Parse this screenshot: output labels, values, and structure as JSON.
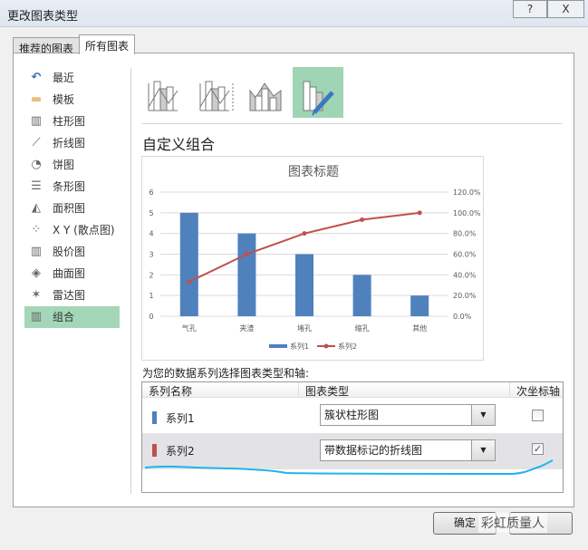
{
  "window": {
    "title": "更改图表类型",
    "help_label": "?",
    "close_label": "X"
  },
  "tabs": [
    {
      "label": "推荐的图表",
      "active": false
    },
    {
      "label": "所有图表",
      "active": true
    }
  ],
  "sidebar": {
    "items": [
      {
        "label": "最近",
        "icon": "undo-icon"
      },
      {
        "label": "模板",
        "icon": "folder-icon"
      },
      {
        "label": "柱形图",
        "icon": "column-chart-icon"
      },
      {
        "label": "折线图",
        "icon": "line-chart-icon"
      },
      {
        "label": "饼图",
        "icon": "pie-chart-icon"
      },
      {
        "label": "条形图",
        "icon": "bar-chart-icon"
      },
      {
        "label": "面积图",
        "icon": "area-chart-icon"
      },
      {
        "label": "X Y (散点图)",
        "icon": "scatter-chart-icon"
      },
      {
        "label": "股价图",
        "icon": "stock-chart-icon"
      },
      {
        "label": "曲面图",
        "icon": "surface-chart-icon"
      },
      {
        "label": "雷达图",
        "icon": "radar-chart-icon"
      },
      {
        "label": "组合",
        "icon": "combo-chart-icon",
        "selected": true
      }
    ],
    "selected_color": "#a3d7b8"
  },
  "main": {
    "section_title": "自定义组合",
    "series_prompt": "为您的数据系列选择图表类型和轴:"
  },
  "chart_data": {
    "type": "bar+line",
    "title": "图表标题",
    "categories": [
      "气孔",
      "夹渣",
      "堵孔",
      "缩孔",
      "其他"
    ],
    "series": [
      {
        "name": "系列1",
        "type": "bar",
        "axis": "primary",
        "color": "#4f81bd",
        "values": [
          5,
          4,
          3,
          2,
          1
        ]
      },
      {
        "name": "系列2",
        "type": "line",
        "axis": "secondary",
        "color": "#c0504d",
        "values": [
          33.3,
          60.0,
          80.0,
          93.3,
          100.0
        ]
      }
    ],
    "ylim": [
      0,
      6
    ],
    "yticks": [
      "0",
      "1",
      "2",
      "3",
      "4",
      "5",
      "6"
    ],
    "y2lim": [
      0,
      120
    ],
    "y2ticks": [
      "0.0%",
      "20.0%",
      "40.0%",
      "60.0%",
      "80.0%",
      "100.0%",
      "120.0%"
    ],
    "grid": true,
    "legend": "bottom"
  },
  "table": {
    "headers": [
      "系列名称",
      "图表类型",
      "次坐标轴"
    ],
    "rows": [
      {
        "name": "系列1",
        "color": "#4f81bd",
        "chart_type": "簇状柱形图",
        "secondary_axis": false
      },
      {
        "name": "系列2",
        "color": "#c0504d",
        "chart_type": "带数据标记的折线图",
        "secondary_axis": true
      }
    ]
  },
  "buttons": {
    "ok": "确定",
    "watermark": "彩虹质量人"
  }
}
